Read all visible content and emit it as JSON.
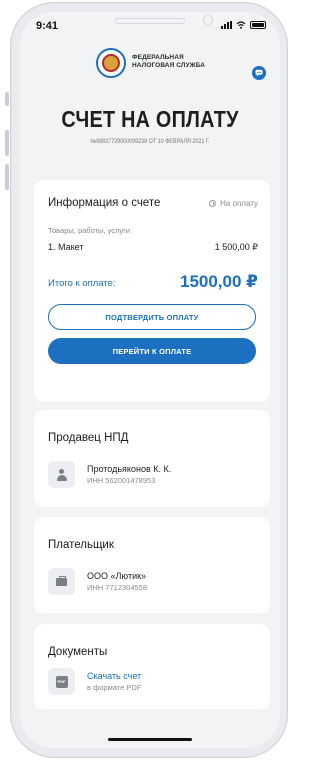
{
  "status": {
    "time": "9:41"
  },
  "header": {
    "org_line1": "ФЕДЕРАЛЬНАЯ",
    "org_line2": "НАЛОГОВАЯ СЛУЖБА",
    "logo_icon": "fns-emblem-icon",
    "chat_icon": "chat-icon"
  },
  "invoice": {
    "title": "СЧЕТ НА ОПЛАТУ",
    "subtitle": "№99837729000099238 ОТ 10 ФЕВРАЛЯ 2021 Г."
  },
  "info_card": {
    "title": "Информация о счете",
    "status": "На оплату",
    "goods_label": "Товары, работы, услуги",
    "items": [
      {
        "name": "1. Макет",
        "price": "1 500,00 ₽"
      }
    ],
    "total_label": "Итого к оплате:",
    "total_value": "1500,00 ₽",
    "confirm_button": "ПОДТВЕРДИТЬ ОПЛАТУ",
    "pay_button": "ПЕРЕЙТИ К ОПЛАТЕ"
  },
  "seller": {
    "title": "Продавец НПД",
    "name": "Протодьяконов К. К.",
    "inn": "ИНН 562001478953"
  },
  "payer": {
    "title": "Плательщик",
    "name": "ООО «Лютик»",
    "inn": "ИНН 7712304558"
  },
  "documents": {
    "title": "Документы",
    "link": "Скачать счет",
    "format": "в формате PDF",
    "pdf_label": "PDF"
  },
  "colors": {
    "accent": "#1d6fbf",
    "background": "#f2f3f5",
    "card": "#ffffff"
  }
}
